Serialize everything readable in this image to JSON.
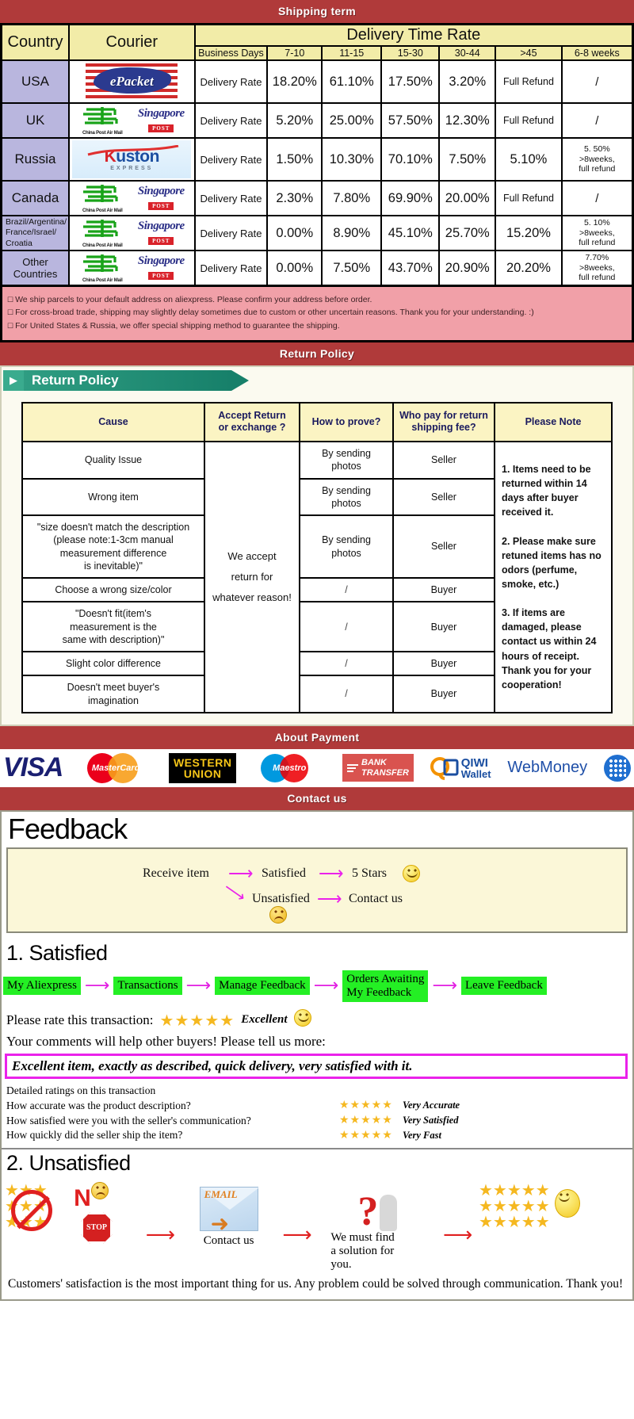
{
  "banners": {
    "shipping": "Shipping term",
    "return": "Return Policy",
    "payment": "About Payment",
    "contact": "Contact us"
  },
  "shipping_table": {
    "headers": {
      "country": "Country",
      "courier": "Courier",
      "delivery_time_rate": "Delivery Time Rate",
      "business_days": "Business Days",
      "ranges": [
        "7-10",
        "11-15",
        "15-30",
        "30-44",
        ">45",
        "6-8 weeks"
      ]
    },
    "rows": [
      {
        "country": "USA",
        "couriers": [
          "epacket"
        ],
        "rate_label": "Delivery Rate",
        "values": [
          "18.20%",
          "61.10%",
          "17.50%",
          "3.20%",
          "Full Refund",
          "/"
        ]
      },
      {
        "country": "UK",
        "couriers": [
          "china-post-air-mail",
          "singapore-post"
        ],
        "rate_label": "Delivery Rate",
        "values": [
          "5.20%",
          "25.00%",
          "57.50%",
          "12.30%",
          "Full Refund",
          "/"
        ]
      },
      {
        "country": "Russia",
        "couriers": [
          "kuston-express"
        ],
        "rate_label": "Delivery Rate",
        "values": [
          "1.50%",
          "10.30%",
          "70.10%",
          "7.50%",
          "5.10%",
          "5. 50%\n>8weeks,\nfull refund"
        ]
      },
      {
        "country": "Canada",
        "couriers": [
          "china-post-air-mail",
          "singapore-post"
        ],
        "rate_label": "Delivery Rate",
        "values": [
          "2.30%",
          "7.80%",
          "69.90%",
          "20.00%",
          "Full Refund",
          "/"
        ]
      },
      {
        "country": "Brazil/Argentina/\nFrance/Israel/\nCroatia",
        "couriers": [
          "china-post-air-mail",
          "singapore-post"
        ],
        "rate_label": "Delivery Rate",
        "values": [
          "0.00%",
          "8.90%",
          "45.10%",
          "25.70%",
          "15.20%",
          "5. 10%\n>8weeks,\nfull refund"
        ]
      },
      {
        "country": "Other Countries",
        "couriers": [
          "china-post-air-mail",
          "singapore-post"
        ],
        "rate_label": "Delivery Rate",
        "values": [
          "0.00%",
          "7.50%",
          "43.70%",
          "20.90%",
          "20.20%",
          "7.70%\n>8weeks,\nfull refund"
        ]
      }
    ],
    "notes": [
      "We ship parcels to your default address on aliexpress. Please confirm your address before order.",
      "For cross-broad trade, shipping may slightly delay sometimes due to custom or other uncertain reasons. Thank you for your understanding. :)",
      "For United States & Russia, we offer special shipping method to guarantee the shipping."
    ]
  },
  "return_policy": {
    "tab_label": "Return Policy",
    "headers": [
      "Cause",
      "Accept Return\nor exchange ?",
      "How to prove?",
      "Who pay for return\nshipping fee?",
      "Please Note"
    ],
    "accept_text": "We accept\nreturn for\nwhatever reason!",
    "note_text": "1. Items need to be returned within 14 days after buyer received it.\n\n2. Please make sure retuned items has no odors (perfume, smoke, etc.)\n\n3. If items are damaged, please contact us within 24 hours of receipt.\nThank you for your cooperation!",
    "rows": [
      {
        "cause": "Quality Issue",
        "prove": "By sending\nphotos",
        "payer": "Seller"
      },
      {
        "cause": "Wrong item",
        "prove": "By sending\nphotos",
        "payer": "Seller"
      },
      {
        "cause": "\"size doesn't match the description\n(please note:1-3cm manual\nmeasurement difference\nis inevitable)\"",
        "prove": "By sending\nphotos",
        "payer": "Seller"
      },
      {
        "cause": "Choose a wrong size/color",
        "prove": "/",
        "payer": "Buyer"
      },
      {
        "cause": "\"Doesn't fit(item's\nmeasurement is the\nsame with description)\"",
        "prove": "/",
        "payer": "Buyer"
      },
      {
        "cause": "Slight color difference",
        "prove": "/",
        "payer": "Buyer"
      },
      {
        "cause": "Doesn't meet buyer's\nimagination",
        "prove": "/",
        "payer": "Buyer"
      }
    ]
  },
  "payments": [
    {
      "name": "visa-logo",
      "label": "VISA"
    },
    {
      "name": "mastercard-logo",
      "label": "MasterCard"
    },
    {
      "name": "western-union-logo",
      "label": "WESTERN\nUNION"
    },
    {
      "name": "maestro-logo",
      "label": "Maestro"
    },
    {
      "name": "bank-transfer-logo",
      "label": "BANK\nTRANSFER"
    },
    {
      "name": "qiwi-wallet-logo",
      "label": "QIWI\nWallet"
    },
    {
      "name": "webmoney-logo",
      "label": "WebMoney"
    }
  ],
  "feedback": {
    "title": "Feedback",
    "flow": {
      "receive": "Receive item",
      "satisfied": "Satisfied",
      "five_stars": "5 Stars",
      "unsatisfied": "Unsatisfied",
      "contact": "Contact us"
    },
    "satisfied": {
      "heading": "1. Satisfied",
      "chain": [
        "My Aliexpress",
        "Transactions",
        "Manage Feedback",
        "Orders Awaiting\nMy Feedback",
        "Leave Feedback"
      ],
      "rate_prompt": "Please rate this transaction:",
      "stars": "★★★★★",
      "rating_word": "Excellent",
      "comment_prompt": "Your comments will help other buyers! Please tell us more:",
      "comment_text": "Excellent item, exactly as described, quick delivery, very satisfied with it.",
      "detailed_title": "Detailed ratings on this transaction",
      "detail_rows": [
        {
          "question": "How accurate was the product description?",
          "stars": "★★★★★",
          "label": "Very Accurate"
        },
        {
          "question": "How satisfied were you with the seller's communication?",
          "stars": "★★★★★",
          "label": "Very Satisfied"
        },
        {
          "question": "How quickly did the seller ship the item?",
          "stars": "★★★★★",
          "label": "Very Fast"
        }
      ]
    },
    "unsatisfied": {
      "heading": "2. Unsatisfied",
      "no_label": "N",
      "stop_label": "STOP",
      "email_label": "EMAIL",
      "contact_caption": "Contact us",
      "solution_caption": "We must find\na solution for\nyou.",
      "stars_block": "★★★★★",
      "footnote": "Customers' satisfaction is the most important thing for us. Any problem could be solved through communication. Thank you!"
    }
  },
  "colors": {
    "banner_red": "#b03a3a",
    "header_yellow": "#f2eca8",
    "country_purple": "#b9b6de",
    "note_pink": "#f1a0a8",
    "chip_green": "#24ef24",
    "magenta": "#ea22ea",
    "star_gold": "#f5b820"
  }
}
